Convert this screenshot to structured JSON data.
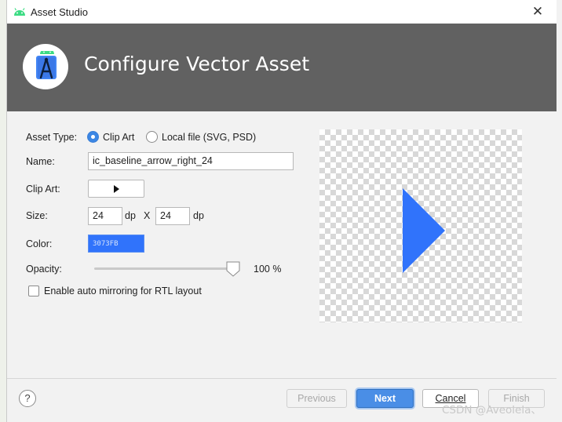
{
  "window": {
    "title": "Asset Studio",
    "close_glyph": "✕",
    "app_icon": "android-icon"
  },
  "header": {
    "heading": "Configure Vector Asset",
    "logo_icon": "android-studio-logo-icon",
    "background_color": "#616161"
  },
  "form": {
    "asset_type_label": "Asset Type:",
    "asset_type_options": [
      "Clip Art",
      "Local file (SVG, PSD)"
    ],
    "asset_type_selected": "Clip Art",
    "name_label": "Name:",
    "name_value": "ic_baseline_arrow_right_24",
    "clip_art_label": "Clip Art:",
    "clip_art_icon": "arrow-right-icon",
    "size_label": "Size:",
    "width_value": "24",
    "width_unit": "dp",
    "size_separator": "X",
    "height_value": "24",
    "height_unit": "dp",
    "color_label": "Color:",
    "color_value": "3073FB",
    "opacity_label": "Opacity:",
    "opacity_value": "100 %",
    "opacity_fraction": 1.0,
    "rtl_mirroring_label": "Enable auto mirroring for RTL layout",
    "rtl_mirroring_checked": false
  },
  "preview": {
    "icon": "arrow-right-icon",
    "icon_color": "#3073FB"
  },
  "footer": {
    "help_label": "?",
    "previous_label": "Previous",
    "next_label": "Next",
    "cancel_label": "Cancel",
    "finish_label": "Finish"
  },
  "watermark": "CSDN @Aveolela、",
  "accent_color": "#4a8ee6"
}
